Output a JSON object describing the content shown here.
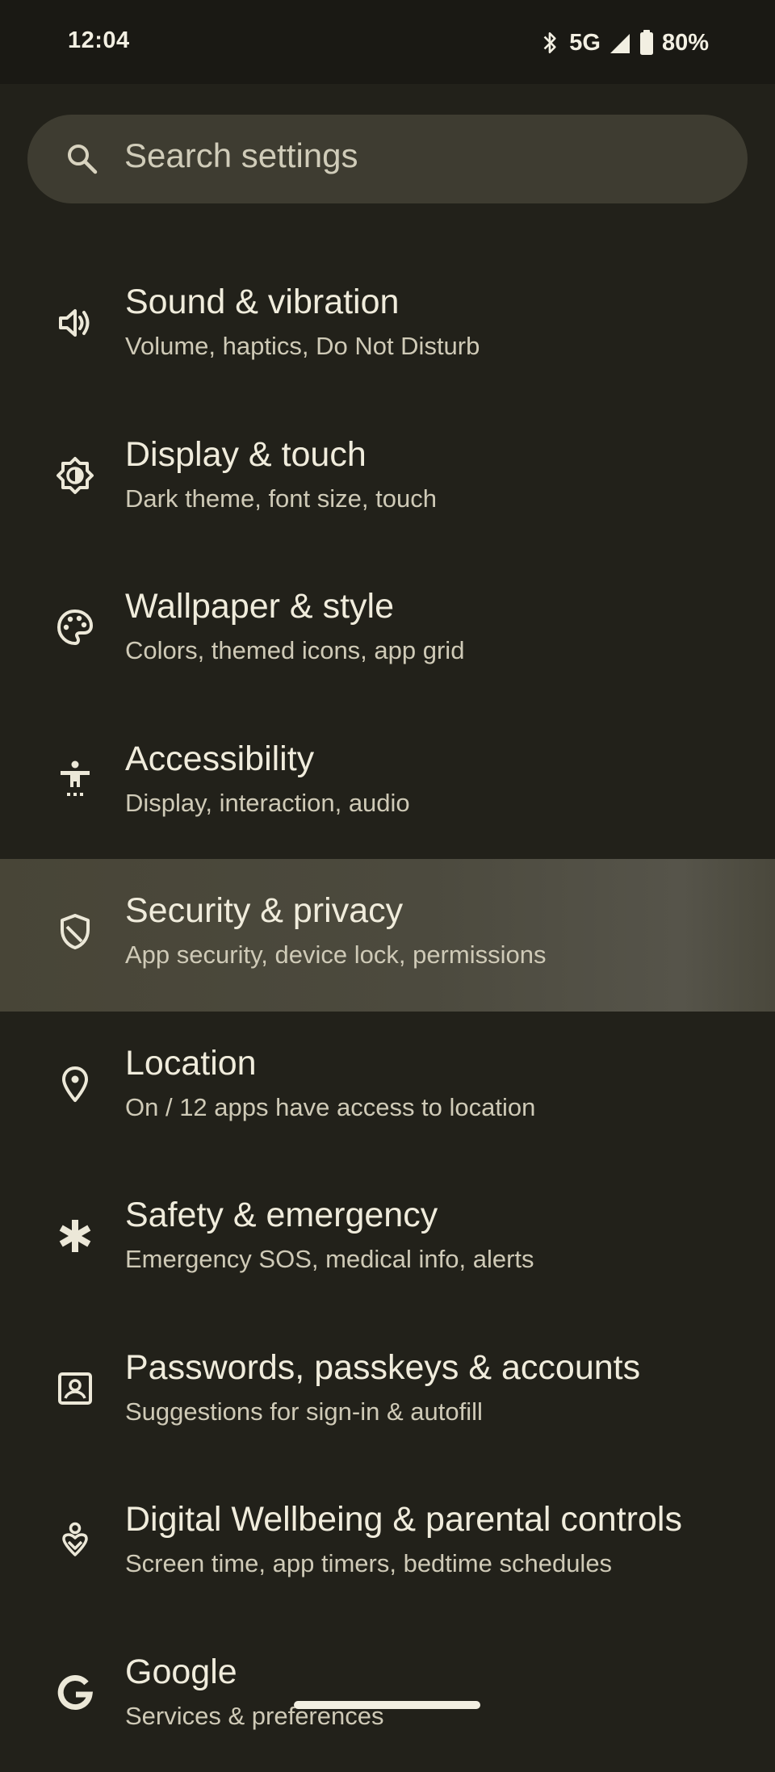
{
  "status_bar": {
    "time": "12:04",
    "network": "5G",
    "battery": "80%"
  },
  "search": {
    "placeholder": "Search settings"
  },
  "settings": [
    {
      "title": "Sound & vibration",
      "subtitle": "Volume, haptics, Do Not Disturb",
      "icon": "volume-icon"
    },
    {
      "title": "Display & touch",
      "subtitle": "Dark theme, font size, touch",
      "icon": "brightness-icon"
    },
    {
      "title": "Wallpaper & style",
      "subtitle": "Colors, themed icons, app grid",
      "icon": "palette-icon"
    },
    {
      "title": "Accessibility",
      "subtitle": "Display, interaction, audio",
      "icon": "accessibility-icon"
    },
    {
      "title": "Security & privacy",
      "subtitle": "App security, device lock, permissions",
      "icon": "shield-icon"
    },
    {
      "title": "Location",
      "subtitle": "On / 12 apps have access to location",
      "icon": "location-pin-icon"
    },
    {
      "title": "Safety & emergency",
      "subtitle": "Emergency SOS, medical info, alerts",
      "icon": "asterisk-icon"
    },
    {
      "title": "Passwords, passkeys & accounts",
      "subtitle": "Suggestions for sign-in & autofill",
      "icon": "account-box-icon"
    },
    {
      "title": "Digital Wellbeing & parental controls",
      "subtitle": "Screen time, app timers, bedtime schedules",
      "icon": "wellbeing-icon"
    },
    {
      "title": "Google",
      "subtitle": "Services & preferences",
      "icon": "google-icon"
    }
  ],
  "colors": {
    "background": "#22211a",
    "status_bar": "#1a1914",
    "search_bar": "#3e3c31",
    "highlight_row": "#4c4a3e",
    "text_primary": "#f0ecdc",
    "text_secondary": "#cfcab7"
  }
}
